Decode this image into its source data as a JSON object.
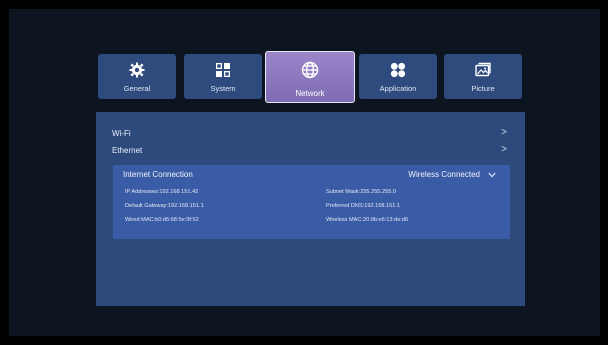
{
  "tabs": [
    {
      "label": "General",
      "icon": "gear-icon"
    },
    {
      "label": "System",
      "icon": "grid-icon"
    },
    {
      "label": "Network",
      "icon": "globe-icon"
    },
    {
      "label": "Application",
      "icon": "apps-icon"
    },
    {
      "label": "Picture",
      "icon": "image-icon"
    }
  ],
  "active_tab": "Network",
  "menu": {
    "wifi_label": "Wi-Fi",
    "ethernet_label": "Ethernet",
    "chevron": ">"
  },
  "connection": {
    "title": "Internet Connection",
    "status": "Wireless Connected",
    "ip": "IP Addresses:192.168.151.42",
    "subnet": "Subnet Mask:255.255.255.0",
    "gateway": "Default Gateway:192.168.151.1",
    "dns": "Preferred DNS:192.168.151.1",
    "wired_mac": "Wired MAC:b0:d5:68:5e:9f:52",
    "wireless_mac": "Wireless MAC:20:9b:e6:13:de:d6"
  },
  "colors": {
    "panel": "#2e4a7d",
    "tab": "#2f4b7e",
    "active_tab": "#8f7bc2",
    "connection_block": "#3a5ba6"
  }
}
